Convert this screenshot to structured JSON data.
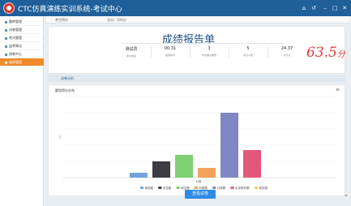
{
  "window": {
    "title": "CTC仿真演练实训系统-考试中心",
    "controls": [
      "⌂",
      "↺",
      "–",
      "□",
      "✕"
    ]
  },
  "sidebar": {
    "items": [
      {
        "label": "题库管理",
        "active": false
      },
      {
        "label": "试卷管理",
        "active": false
      },
      {
        "label": "考试管理",
        "active": false
      },
      {
        "label": "监考情况",
        "active": false
      },
      {
        "label": "阅卷中心",
        "active": false
      },
      {
        "label": "成绩管理",
        "active": true
      }
    ]
  },
  "topinfo": {
    "label": "考生得分",
    "total": "总分：100分"
  },
  "report": {
    "title": "成绩报告单",
    "stats": [
      {
        "value": "测试员",
        "label": "考生姓名"
      },
      {
        "value": "00:31",
        "label": "答题时间"
      },
      {
        "value": "3",
        "label": "未交卷试卷数"
      },
      {
        "value": "5",
        "label": "考试人数"
      },
      {
        "value": "24.37",
        "label": "平均分"
      }
    ],
    "score": "63.5",
    "score_unit": "分"
  },
  "tabs": {
    "analysis": "试卷分析"
  },
  "chart_panel": {
    "title": "题型得分分布",
    "menu_icon": "menu-icon",
    "view_button": "查看试卷"
  },
  "chart_data": {
    "type": "bar",
    "xlabel": "分数",
    "ylabel": "",
    "ylim": [
      0,
      5
    ],
    "grid": true,
    "legend_position": "bottom",
    "series": [
      {
        "name": "单选题",
        "color": "#72a3db",
        "value": 0.3
      },
      {
        "name": "多选题",
        "color": "#3c3c44",
        "value": 1.0
      },
      {
        "name": "填空题",
        "color": "#80cf72",
        "value": 1.4
      },
      {
        "name": "判断题",
        "color": "#f2a25a",
        "value": 0.6
      },
      {
        "name": "计算题",
        "color": "#8186c4",
        "value": 4.0
      },
      {
        "name": "实训操作题",
        "color": "#e5577a",
        "value": 1.7
      },
      {
        "name": "简答题",
        "color": "#f0d25a",
        "value": 0.0
      }
    ]
  }
}
